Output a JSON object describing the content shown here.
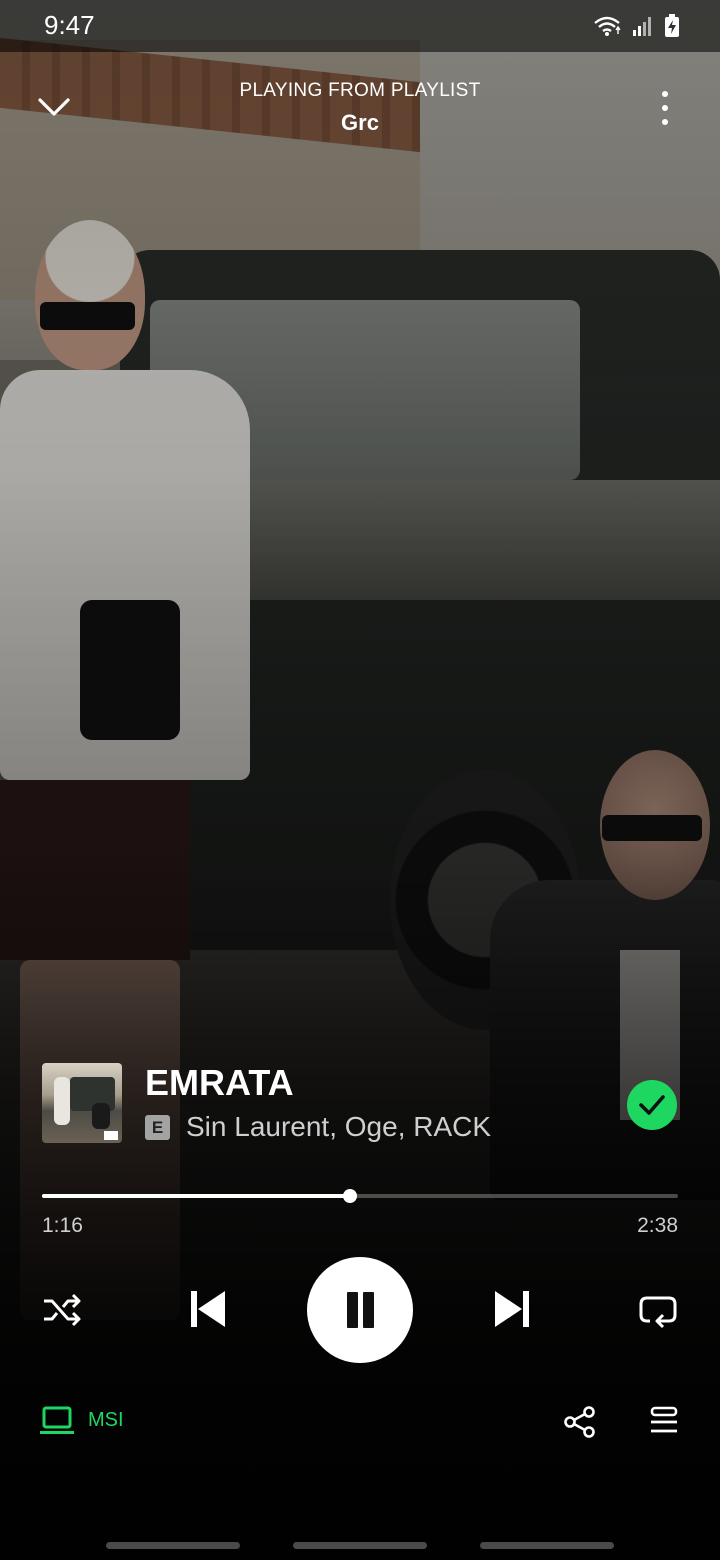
{
  "status_bar": {
    "time": "9:47",
    "icons": [
      "wifi-icon",
      "signal-icon",
      "battery-charging-icon"
    ]
  },
  "header": {
    "context_label": "PLAYING FROM PLAYLIST",
    "playlist_name": "Grc",
    "icons": [
      "chevron-down-icon",
      "more-vertical-icon"
    ]
  },
  "track": {
    "title": "EMRATA",
    "explicit_badge": "E",
    "artists": "Sin Laurent, Oge, RACK",
    "liked": true
  },
  "progress": {
    "elapsed": "1:16",
    "total": "2:38",
    "fraction": 0.484
  },
  "controls": {
    "icons": [
      "shuffle-icon",
      "skip-previous-icon",
      "pause-icon",
      "skip-next-icon",
      "repeat-icon"
    ]
  },
  "bottom_bar": {
    "device_name": "MSI",
    "icons": [
      "laptop-icon",
      "share-icon",
      "queue-icon"
    ]
  },
  "colors": {
    "accent": "#1ed760",
    "text_primary": "#ffffff",
    "text_secondary": "#cfcfcf"
  }
}
